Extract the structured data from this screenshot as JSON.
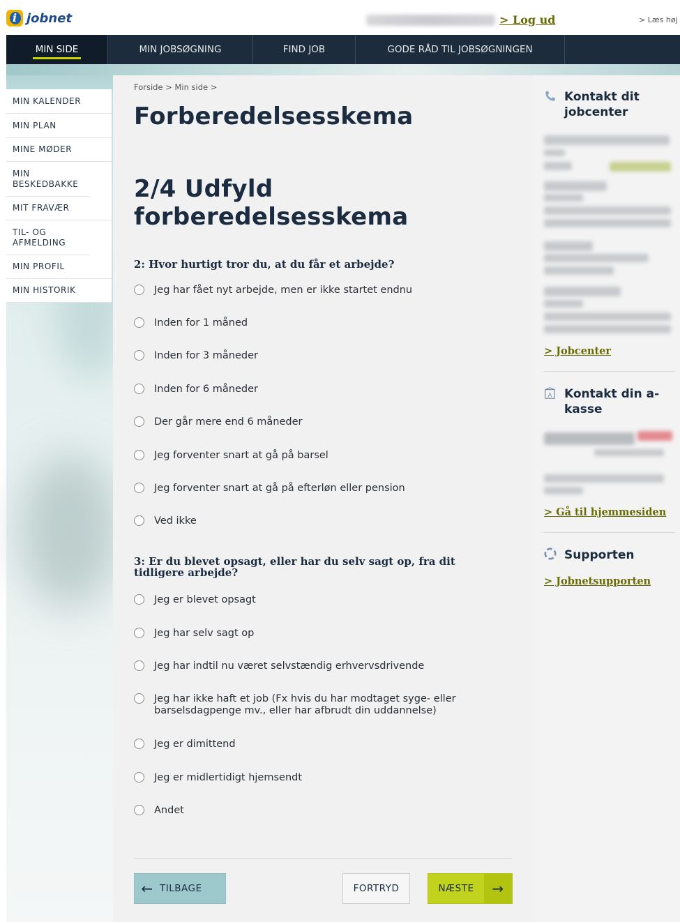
{
  "header": {
    "logo_text": "jobnet",
    "logo_letter": "i",
    "logout": "> Log ud",
    "read_aloud": "> Læs høj"
  },
  "nav": {
    "items": [
      "MIN SIDE",
      "MIN JOBSØGNING",
      "FIND JOB",
      "GODE RÅD TIL JOBSØGNINGEN"
    ]
  },
  "sidebar": {
    "items": [
      "MIN KALENDER",
      "MIN PLAN",
      "MINE MØDER",
      "MIN BESKEDBAKKE",
      "MIT FRAVÆR",
      "TIL- OG AFMELDING",
      "MIN PROFIL",
      "MIN HISTORIK"
    ]
  },
  "breadcrumb": {
    "home": "Forside",
    "sep": ">",
    "current": "Min side",
    "trail_end": ">"
  },
  "page_title": "Forberedelsesskema",
  "step_title": "2/4 Udfyld forberedelsesskema",
  "q2": {
    "question": "2: Hvor hurtigt tror du, at du får et arbejde?",
    "options": [
      "Jeg har fået nyt arbejde, men er ikke startet endnu",
      "Inden for 1 måned",
      "Inden for 3 måneder",
      "Inden for 6 måneder",
      "Der går mere end 6 måneder",
      "Jeg forventer snart at gå på barsel",
      "Jeg forventer snart at gå på efterløn eller pension",
      "Ved ikke"
    ]
  },
  "q3": {
    "question": "3: Er du blevet opsagt, eller har du selv sagt op, fra dit tidligere arbejde?",
    "options": [
      "Jeg er blevet opsagt",
      "Jeg har selv sagt op",
      "Jeg har indtil nu været selvstændig erhvervsdrivende",
      "Jeg har ikke haft et job (Fx hvis du har modtaget syge- eller barselsdagpenge mv., eller har afbrudt din uddannelse)",
      "Jeg er dimittend",
      "Jeg er midlertidigt hjemsendt",
      "Andet"
    ]
  },
  "buttons": {
    "back": "TILBAGE",
    "cancel": "FORTRYD",
    "next": "NÆSTE",
    "back_arrow": "←",
    "next_arrow": "→"
  },
  "right": {
    "contact_jobcenter": "Kontakt dit jobcenter",
    "jobcenter_link": "> Jobcenter",
    "contact_akasse": "Kontakt din a-kasse",
    "akasse_link": "> Gå til hjemmesiden",
    "support_title": "Supporten",
    "support_link": "> Jobnetsupporten"
  },
  "colors": {
    "nav_bg": "#1d2c3d",
    "accent": "#c2d31d",
    "link": "#6a6c07"
  }
}
